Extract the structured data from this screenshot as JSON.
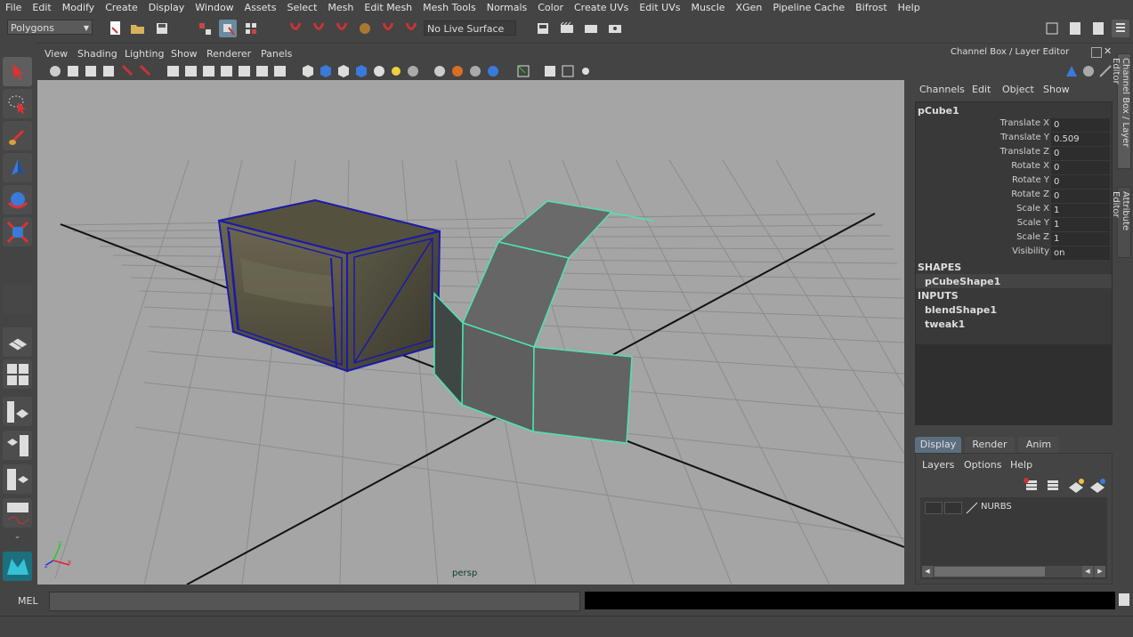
{
  "menubar": [
    "File",
    "Edit",
    "Modify",
    "Create",
    "Display",
    "Window",
    "Assets",
    "Select",
    "Mesh",
    "Edit Mesh",
    "Mesh Tools",
    "Normals",
    "Color",
    "Create UVs",
    "Edit UVs",
    "Muscle",
    "XGen",
    "Pipeline Cache",
    "Bifrost",
    "Help"
  ],
  "statusline": {
    "mode": "Polygons",
    "live_surface": "No Live Surface"
  },
  "panel_menu": [
    "View",
    "Shading",
    "Lighting",
    "Show",
    "Renderer",
    "Panels"
  ],
  "viewport": {
    "camera": "persp"
  },
  "channel_box": {
    "title": "Channel Box / Layer Editor",
    "menu": [
      "Channels",
      "Edit",
      "Object",
      "Show"
    ],
    "object": "pCube1",
    "attributes": [
      {
        "label": "Translate X",
        "value": "0"
      },
      {
        "label": "Translate Y",
        "value": "0.509"
      },
      {
        "label": "Translate Z",
        "value": "0"
      },
      {
        "label": "Rotate X",
        "value": "0"
      },
      {
        "label": "Rotate Y",
        "value": "0"
      },
      {
        "label": "Rotate Z",
        "value": "0"
      },
      {
        "label": "Scale X",
        "value": "1"
      },
      {
        "label": "Scale Y",
        "value": "1"
      },
      {
        "label": "Scale Z",
        "value": "1"
      },
      {
        "label": "Visibility",
        "value": "on"
      }
    ],
    "shapes_header": "SHAPES",
    "shapes": [
      "pCubeShape1"
    ],
    "inputs_header": "INPUTS",
    "inputs": [
      "blendShape1",
      "tweak1"
    ]
  },
  "side_tabs": [
    "Channel Box / Layer Editor",
    "Attribute Editor"
  ],
  "layer_editor": {
    "tabs": [
      "Display",
      "Render",
      "Anim"
    ],
    "menu": [
      "Layers",
      "Options",
      "Help"
    ],
    "layers": [
      {
        "name": "NURBS"
      }
    ]
  },
  "command_line": {
    "label": "MEL"
  },
  "colors": {
    "ui_bg": "#444444",
    "viewport_bg": "#a5a5a5",
    "selection_green": "#4fe3b0",
    "crate_wire": "#1a1aa8"
  }
}
